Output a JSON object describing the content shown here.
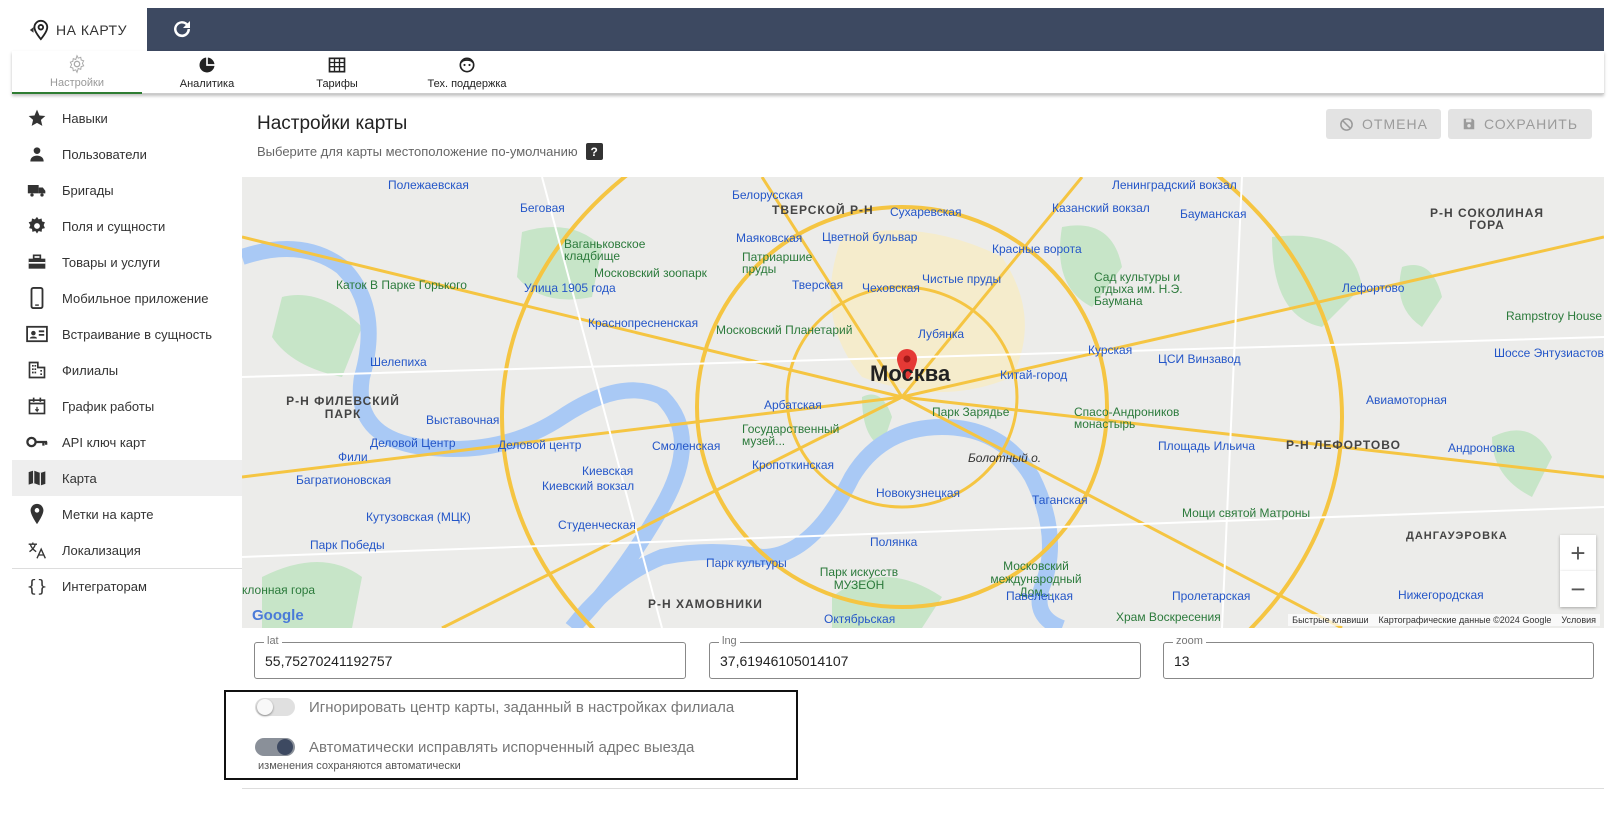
{
  "topbar": {
    "brand_label": "НА КАРТУ",
    "accent_color": "#3d4961"
  },
  "tabs": [
    {
      "label": "Настройки",
      "icon": "gear-icon"
    },
    {
      "label": "Аналитика",
      "icon": "pie-chart-icon"
    },
    {
      "label": "Тарифы",
      "icon": "table-icon"
    },
    {
      "label": "Тех. поддержка",
      "icon": "support-face-icon"
    }
  ],
  "sidebar": {
    "items": [
      {
        "label": "Навыки",
        "icon": "star-icon"
      },
      {
        "label": "Пользователи",
        "icon": "user-icon"
      },
      {
        "label": "Бригады",
        "icon": "truck-icon"
      },
      {
        "label": "Поля и сущности",
        "icon": "gear-icon"
      },
      {
        "label": "Товары и услуги",
        "icon": "toolbox-icon"
      },
      {
        "label": "Мобильное приложение",
        "icon": "phone-icon"
      },
      {
        "label": "Встраивание в сущность",
        "icon": "id-card-icon"
      },
      {
        "label": "Филиалы",
        "icon": "building-icon"
      },
      {
        "label": "График работы",
        "icon": "calendar-icon"
      },
      {
        "label": "API ключ карт",
        "icon": "key-icon"
      },
      {
        "label": "Карта",
        "icon": "map-icon"
      },
      {
        "label": "Метки на карте",
        "icon": "pin-icon"
      },
      {
        "label": "Локализация",
        "icon": "translate-icon"
      },
      {
        "label": "Интеграторам",
        "icon": "braces-icon"
      }
    ]
  },
  "main": {
    "title": "Настройки карты",
    "subtitle": "Выберите для карты местоположение по-умолчанию",
    "help_label": "?",
    "cancel_label": "ОТМЕНА",
    "save_label": "СОХРАНИТЬ"
  },
  "map": {
    "city_label": "Москва",
    "labels": {
      "tverskoy": "ТВЕРСКОЙ Р-Н",
      "sokolinaya": "Р-Н СОКОЛИНАЯ ГОРА",
      "filevsky": "Р-Н ФИЛЕВСКИЙ ПАРК",
      "lefortovo": "Р-Н ЛЕФОРТОВО",
      "khamovniki": "Р-Н ХАМОВНИКИ",
      "dangauer": "ДАНГАУЭРОВКА",
      "belorusskaya": "Белорусская",
      "leningradsky": "Ленинградский вокзал",
      "kazansky": "Казанский вокзал",
      "baumanskaya": "Бауманская",
      "sukharevskaya": "Сухаревская",
      "begovaya": "Беговая",
      "polezhaevskaya": "Полежаевская",
      "vagankovskoe": "Ваганьковское кладбище",
      "zoo": "Московский зоопарк",
      "patriarshie": "Патриаршие пруды",
      "mayakovskaya": "Маяковская",
      "tsvetnoy": "Цветной бульвар",
      "krasnye_vorota": "Красные ворота",
      "chistye_prudy": "Чистые пруды",
      "tverskaya": "Тверская",
      "chekhovskaya": "Чеховская",
      "katok": "Каток В Парке Горького",
      "ulitsa1905": "Улица 1905 года",
      "krasnopresnenskaya": "Краснопресненская",
      "planetarium": "Московский Планетарий",
      "lubyanka": "Лубянка",
      "kurskaya": "Курская",
      "vinzavod": "ЦСИ Винзавод",
      "sad_baumana": "Сад культуры и отдыха им. Н.Э. Баумана",
      "lefortovo_st": "Лефортово",
      "rampstroy": "Rampstroy House",
      "shosse": "Шоссе Энтузиастов",
      "aviamotornaya": "Авиамоторная",
      "andronovka": "Андроновка",
      "shelepikha": "Шелепиха",
      "kitai_gorod": "Китай-город",
      "park_zaryadye": "Парк Зарядье",
      "spaso": "Спасо-Андроников монастырь",
      "ilyicha": "Площадь Ильича",
      "arbatskaya": "Арбатская",
      "vystavochnaya": "Выставочная",
      "delovoy1": "Деловой Центр",
      "delovoy2": "Деловой центр",
      "fili": "Фили",
      "smolenskaya": "Смоленская",
      "gos_muzei": "Государственный музей...",
      "kropotkinskaya": "Кропоткинская",
      "bolotny": "Болотный о.",
      "kievskaya": "Киевская",
      "kievsky_vokzal": "Киевский вокзал",
      "bagrationovskaya": "Багратионовская",
      "novokuznetskaya": "Новокузнецкая",
      "taganskaya": "Таганская",
      "moshchi": "Мощи святой Матроны",
      "kutuzovskaya": "Кутузовская (МЦК)",
      "studencheskaya": "Студенческая",
      "park_pobedy": "Парк Победы",
      "park_kultury": "Парк культуры",
      "polyanka": "Полянка",
      "muzeon": "Парк искусств МУЗЕОН",
      "dom_muz": "Московский международный Дом...",
      "paveletskaya": "Павелецкая",
      "proletarskaya": "Пролетарская",
      "nizhegorodskaya": "Нижегородская",
      "oktyabrskaya": "Октябрьская",
      "khram": "Храм Воскресения",
      "poklonnaya": "клонная гора",
      "google": "Google"
    },
    "attribution": [
      "Быстрые клавиши",
      "Картографические данные ©2024 Google",
      "Условия"
    ],
    "zoom_in": "+",
    "zoom_out": "−",
    "marker_color": "#e53935"
  },
  "fields": {
    "lat": {
      "label": "lat",
      "value": "55,75270241192757"
    },
    "lng": {
      "label": "lng",
      "value": "37,61946105014107"
    },
    "zoom": {
      "label": "zoom",
      "value": "13"
    }
  },
  "options": {
    "ignore_center": {
      "label": "Игнорировать центр карты, заданный в настройках филиала",
      "checked": false
    },
    "auto_fix": {
      "label": "Автоматически исправлять испорченный адрес выезда",
      "checked": true
    },
    "note": "изменения сохраняются автоматически"
  }
}
